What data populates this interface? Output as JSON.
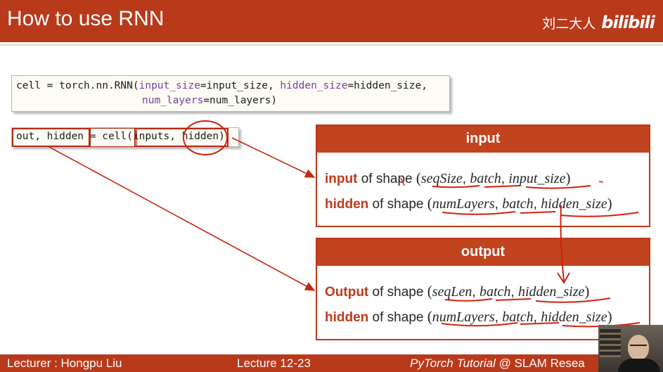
{
  "header": {
    "title": "How to use RNN",
    "brand_text": "刘二大人",
    "brand_logo": "bilibili"
  },
  "code": {
    "line1_a": "cell = torch.nn.RNN(",
    "line1_kw1": "input_size",
    "line1_b": "=input_size, ",
    "line1_kw2": "hidden_size",
    "line1_c": "=hidden_size,",
    "line2_kw": "num_layers",
    "line2_b": "=num_layers)"
  },
  "call": {
    "text": "out, hidden = cell(inputs, hidden)"
  },
  "input_panel": {
    "title": "input",
    "line1_label": "input",
    "line1_of": " of shape ",
    "line1_args": [
      "seqSize",
      "batch",
      "input_size"
    ],
    "line2_label": "hidden",
    "line2_of": " of shape ",
    "line2_args": [
      "numLayers",
      "batch",
      "hidden_size"
    ]
  },
  "output_panel": {
    "title": "output",
    "line1_label": "Output",
    "line1_of": " of shape ",
    "line1_args": [
      "seqLen",
      "batch",
      "hidden_size"
    ],
    "line2_label": "hidden",
    "line2_of": " of shape ",
    "line2_args": [
      "numLayers",
      "batch",
      "hidden_size"
    ]
  },
  "footer": {
    "lecturer": "Lecturer : Hongpu Liu",
    "lecture": "Lecture 12-23",
    "tutorial_italic": "PyTorch Tutorial",
    "tutorial_rest": " @ SLAM Resea"
  },
  "colors": {
    "brand": "#b9391b",
    "annotation": "#c42a12",
    "keyword": "#7b3fa3"
  }
}
